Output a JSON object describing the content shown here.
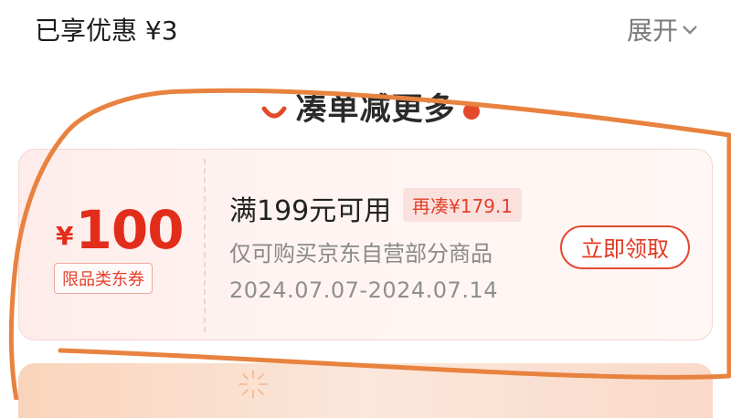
{
  "header": {
    "savings_label": "已享优惠 ¥3",
    "expand_label": "展开",
    "expand_icon": "chevron-down-icon"
  },
  "section": {
    "title": "凑单减更多"
  },
  "coupon": {
    "currency": "¥",
    "amount": "100",
    "category_tag": "限品类东券",
    "condition": "满199元可用",
    "need_more": "再凑¥179.1",
    "scope": "仅可购买京东自营部分商品",
    "validity": "2024.07.07-2024.07.14",
    "claim_label": "立即领取"
  },
  "colors": {
    "accent": "#e32d1b",
    "annotation_stroke": "#e8823f"
  }
}
